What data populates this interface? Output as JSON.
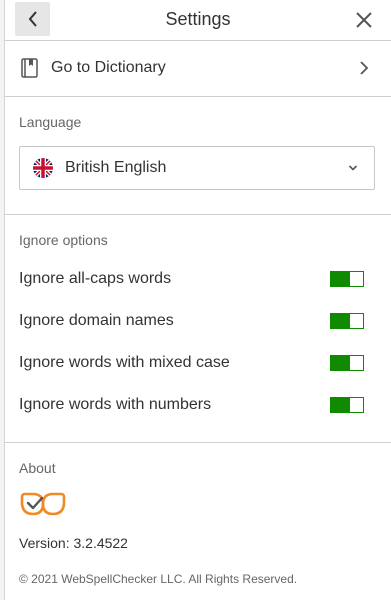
{
  "header": {
    "title": "Settings",
    "back_icon": "chevron-left-icon",
    "close_icon": "close-icon"
  },
  "dictionary": {
    "label": "Go to Dictionary",
    "icon": "book-icon",
    "chevron_icon": "chevron-right-icon"
  },
  "language": {
    "title": "Language",
    "selected": "British English",
    "flag_icon": "uk-flag-icon",
    "dropdown_icon": "chevron-down-icon"
  },
  "ignore": {
    "title": "Ignore options",
    "options": [
      {
        "label": "Ignore all-caps words",
        "enabled": true
      },
      {
        "label": "Ignore domain names",
        "enabled": true
      },
      {
        "label": "Ignore words with mixed case",
        "enabled": true
      },
      {
        "label": "Ignore words with numbers",
        "enabled": true
      }
    ]
  },
  "about": {
    "title": "About",
    "logo_icon": "webspellchecker-logo",
    "version": "Version: 3.2.4522",
    "copyright": "© 2021 WebSpellChecker LLC. All Rights Reserved."
  },
  "colors": {
    "toggle_on": "#108a00",
    "logo_orange": "#f08a24",
    "logo_gray": "#555555",
    "divider": "#cfcfcf"
  }
}
